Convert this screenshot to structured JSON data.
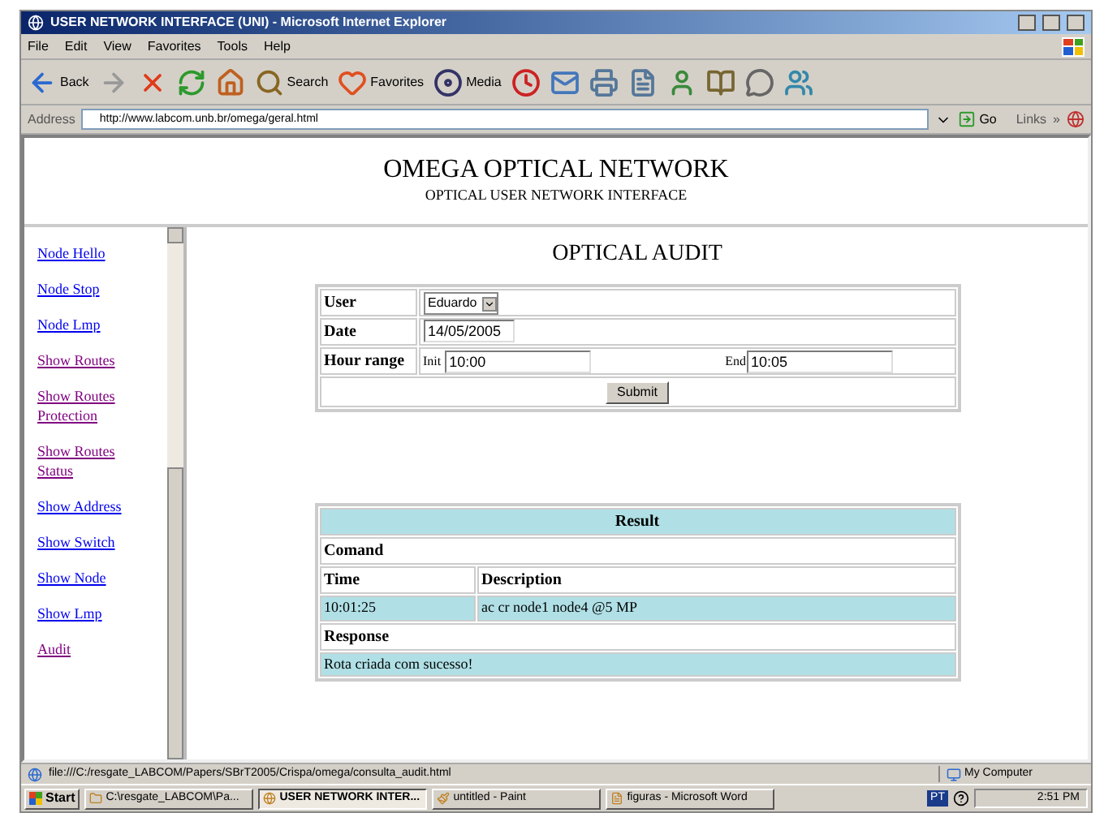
{
  "window": {
    "title": "USER NETWORK INTERFACE (UNI) - Microsoft Internet Explorer"
  },
  "menu": [
    "File",
    "Edit",
    "View",
    "Favorites",
    "Tools",
    "Help"
  ],
  "toolbar": [
    {
      "kind": "back",
      "label": "Back"
    },
    {
      "kind": "forward"
    },
    {
      "kind": "stop"
    },
    {
      "kind": "refresh"
    },
    {
      "kind": "home"
    },
    {
      "kind": "search",
      "label": "Search"
    },
    {
      "kind": "favorites",
      "label": "Favorites"
    },
    {
      "kind": "media",
      "label": "Media"
    },
    {
      "kind": "history"
    },
    {
      "kind": "mail"
    },
    {
      "kind": "print"
    },
    {
      "kind": "edit"
    },
    {
      "kind": "messenger"
    },
    {
      "kind": "research"
    },
    {
      "kind": "discuss"
    },
    {
      "kind": "people"
    }
  ],
  "address": {
    "label": "Address",
    "url": "http://www.labcom.unb.br/omega/geral.html",
    "go": "Go",
    "links": "Links",
    "links_more": "»"
  },
  "header": {
    "title": "OMEGA OPTICAL NETWORK",
    "subtitle": "OPTICAL USER NETWORK INTERFACE"
  },
  "sidebar": {
    "items": [
      {
        "label": "Node Hello",
        "visited": false
      },
      {
        "label": "Node Stop",
        "visited": false
      },
      {
        "label": "Node Lmp",
        "visited": false
      },
      {
        "label": "Show Routes",
        "visited": true
      },
      {
        "label": "Show Routes Protection",
        "visited": true
      },
      {
        "label": "Show Routes Status",
        "visited": true
      },
      {
        "label": "Show Address",
        "visited": false
      },
      {
        "label": "Show Switch",
        "visited": false
      },
      {
        "label": "Show Node",
        "visited": false
      },
      {
        "label": "Show Lmp",
        "visited": false
      },
      {
        "label": "Audit",
        "visited": true
      }
    ]
  },
  "page": {
    "title": "OPTICAL AUDIT"
  },
  "form": {
    "user_label": "User",
    "user_value": "Eduardo",
    "date_label": "Date",
    "date_value": "14/05/2005",
    "hour_label": "Hour range",
    "init_label": "Init",
    "init_value": "10:00",
    "end_label": "End",
    "end_value": "10:05",
    "submit": "Submit"
  },
  "result": {
    "title": "Result",
    "command_label": "Comand",
    "columns": [
      "Time",
      "Description"
    ],
    "rows": [
      [
        "10:01:25",
        "ac cr node1 node4 @5 MP"
      ]
    ],
    "response_label": "Response",
    "response": "Rota criada com sucesso!"
  },
  "status_bar": {
    "text": "file:///C:/resgate_LABCOM/Papers/SBrT2005/Crispa/omega/consulta_audit.html",
    "zone": "My Computer"
  },
  "taskbar": {
    "start": "Start",
    "items": [
      {
        "label": "C:\\resgate_LABCOM\\Pa...",
        "selected": false
      },
      {
        "label": "USER NETWORK INTER...",
        "selected": true
      },
      {
        "label": "untitled - Paint",
        "selected": false
      },
      {
        "label": "figuras - Microsoft Word",
        "selected": false
      }
    ],
    "language": "PT",
    "clock": "2:51 PM"
  }
}
